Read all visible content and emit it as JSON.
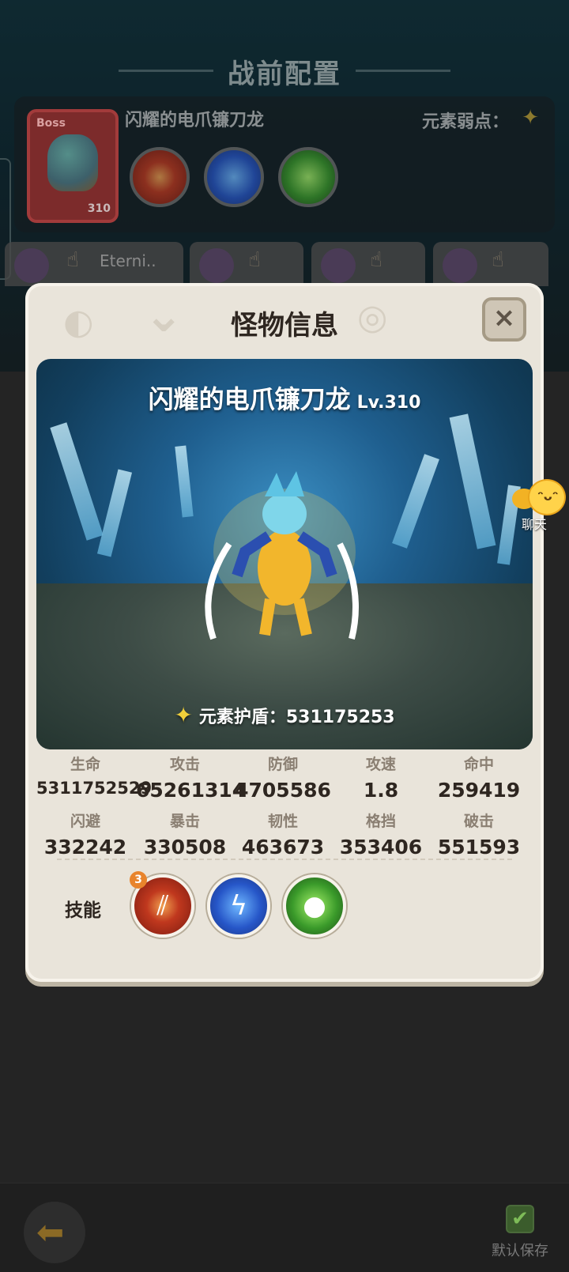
{
  "background": {
    "title": "战前配置",
    "boss": {
      "tag": "Boss",
      "level": "310",
      "name": "闪耀的电爪镰刀龙",
      "weakness_label": "元素弱点：",
      "weakness_icon": "light-element-icon"
    },
    "team_tabs": [
      {
        "name": "Eterni..",
        "icon": "hand-icon"
      },
      {
        "name": "",
        "icon": "hand-icon"
      },
      {
        "name": "",
        "icon": "hand-icon"
      },
      {
        "name": "",
        "icon": "hand-icon"
      }
    ],
    "bottom": {
      "back_icon": "back-arrow-icon",
      "save_label": "默认保存",
      "save_icon": "checkbox-checked-icon"
    }
  },
  "modal": {
    "title": "怪物信息",
    "close_glyph": "×",
    "monster": {
      "name": "闪耀的电爪镰刀龙",
      "level": "Lv.310",
      "shield_label": "元素护盾：",
      "shield_value": "531175253"
    },
    "stats": [
      {
        "label": "生命",
        "value": "5311752529"
      },
      {
        "label": "攻击",
        "value": "65261314"
      },
      {
        "label": "防御",
        "value": "4705586"
      },
      {
        "label": "攻速",
        "value": "1.8"
      },
      {
        "label": "命中",
        "value": "259419"
      },
      {
        "label": "闪避",
        "value": "332242"
      },
      {
        "label": "暴击",
        "value": "330508"
      },
      {
        "label": "韧性",
        "value": "463673"
      },
      {
        "label": "格挡",
        "value": "353406"
      },
      {
        "label": "破击",
        "value": "551593"
      }
    ],
    "skills_label": "技能",
    "skills": [
      {
        "icon": "claw-slash-icon",
        "badge": "3",
        "color": "#c0381e"
      },
      {
        "icon": "lightning-icon",
        "badge": "",
        "color": "#2656c8"
      },
      {
        "icon": "poison-slime-icon",
        "badge": "",
        "color": "#3a9a2a"
      }
    ]
  },
  "chat": {
    "label": "聊天",
    "icon": "chat-bubble-icon"
  }
}
